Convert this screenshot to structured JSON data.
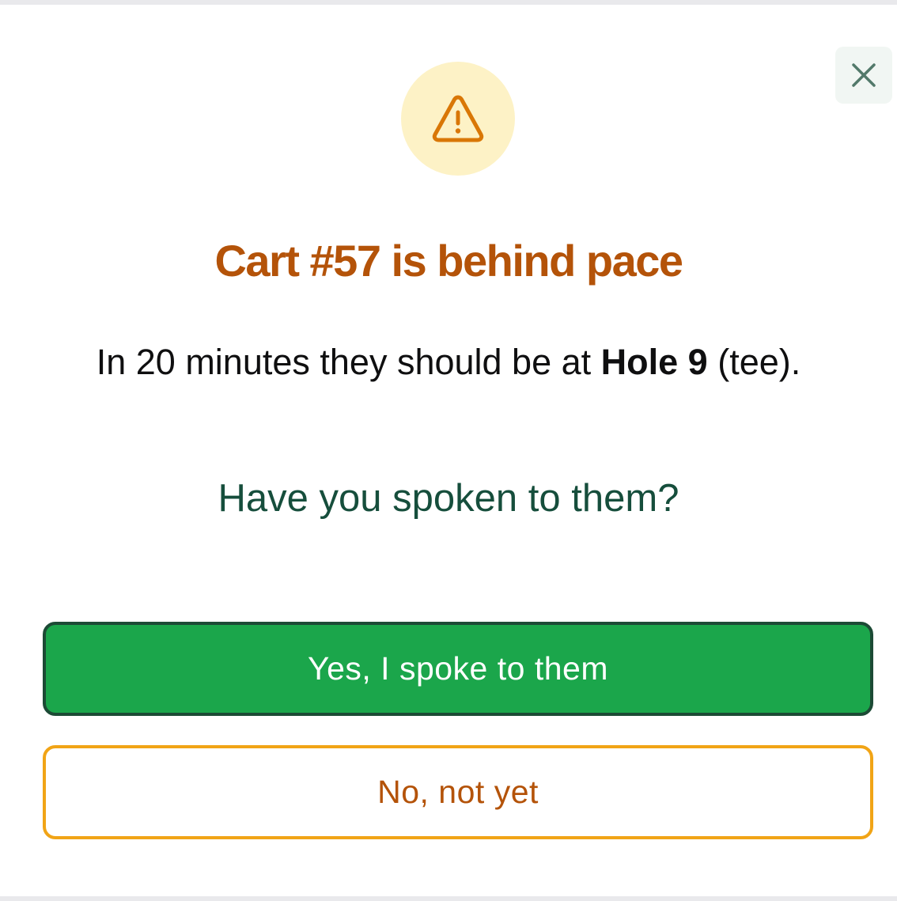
{
  "modal": {
    "close_icon": "close-icon",
    "warning_icon": "warning-triangle-icon",
    "title": "Cart #57 is behind pace",
    "description": {
      "prefix": "In 20 minutes they should be at ",
      "location": "Hole 9",
      "suffix": " (tee)."
    },
    "question": "Have you spoken to them?",
    "yes_button_label": "Yes, I spoke to them",
    "no_button_label": "No, not yet"
  },
  "colors": {
    "title": "#b45309",
    "question": "#164e3c",
    "primary_button": "#1ba64b",
    "secondary_button_border": "#f1a416",
    "warning_circle": "#fdf2c6"
  }
}
